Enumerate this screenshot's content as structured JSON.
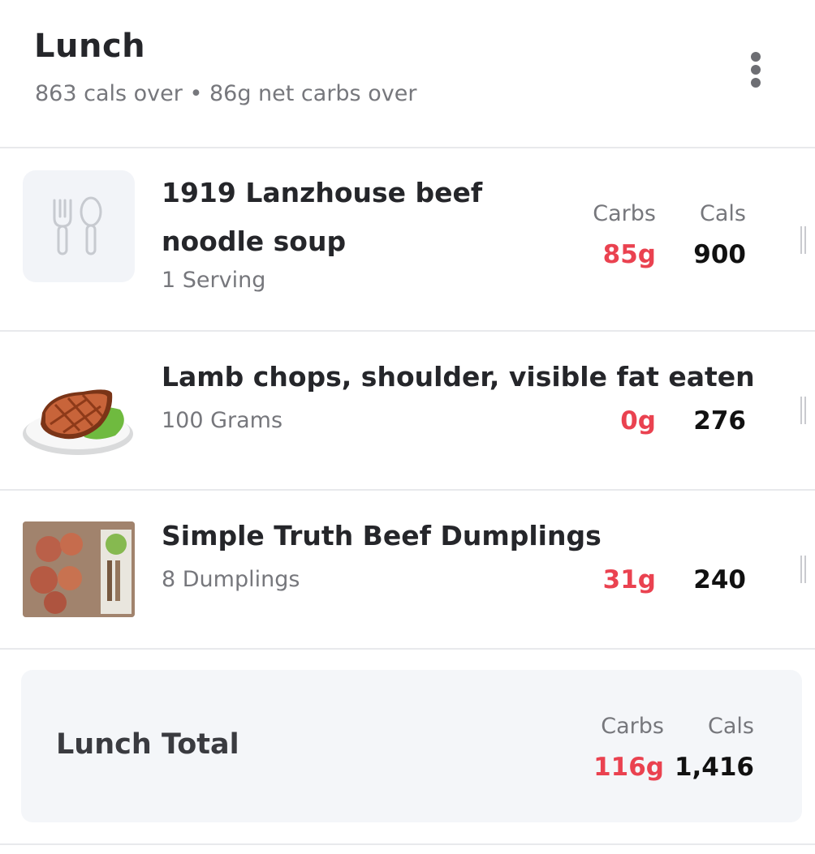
{
  "meal": {
    "title": "Lunch",
    "summary": "863 cals over • 86g net carbs over"
  },
  "columns": {
    "carbs": "Carbs",
    "cals": "Cals"
  },
  "entries": [
    {
      "name_line1": "1919 Lanzhouse beef",
      "name_line2": "noodle soup",
      "quantity": "1 Serving",
      "carbs": "85g",
      "cals": "900",
      "image": "utensils-icon"
    },
    {
      "name": "Lamb chops, shoulder, visible fat eaten",
      "quantity": "100 Grams",
      "carbs": "0g",
      "cals": "276",
      "image": "grilled-meat-plate"
    },
    {
      "name": "Simple Truth Beef Dumplings",
      "quantity": "8 Dumplings",
      "carbs": "31g",
      "cals": "240",
      "image": "dumplings-package-photo"
    }
  ],
  "total": {
    "label": "Lunch Total",
    "carbs": "116g",
    "cals": "1,416"
  },
  "colors": {
    "carbs": "#ea4250",
    "muted": "#76777c",
    "panel": "#f4f6f9",
    "divider": "#e8e9ec"
  }
}
